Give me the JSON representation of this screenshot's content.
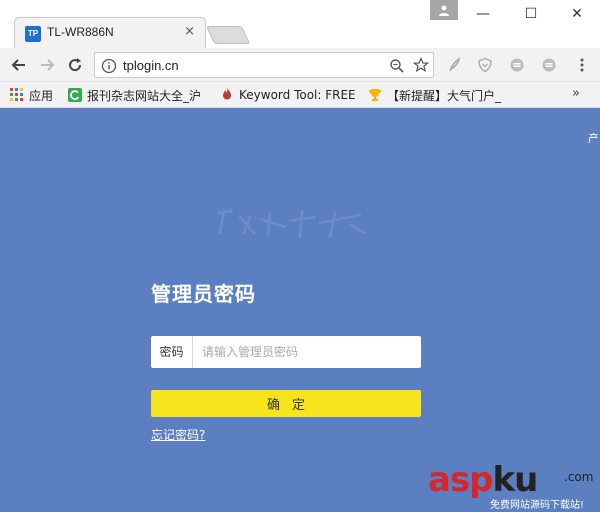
{
  "browser": {
    "tab_title": "TL-WR886N",
    "tab_favicon_text": "TP",
    "tab_close": "×",
    "window_controls": {
      "minimize": "—",
      "maximize": "☐",
      "close": "✕"
    },
    "url": "tplogin.cn"
  },
  "bookmarks": [
    {
      "label": "应用",
      "icon": "apps-grid-icon"
    },
    {
      "label": "报刊杂志网站大全_沪",
      "icon": "refresh-c-icon"
    },
    {
      "label": "Keyword Tool: FREE",
      "icon": "flame-icon"
    },
    {
      "label": "【新提醒】大气门户_",
      "icon": "trophy-icon"
    }
  ],
  "bookmarks_more": "»",
  "page": {
    "corner_text": "产",
    "title": "管理员密码",
    "password_label": "密码",
    "password_placeholder": "请输入管理员密码",
    "password_value": "",
    "confirm_label": "确定",
    "forgot_link": "忘记密码?"
  },
  "watermark": {
    "main_red": "asp",
    "main_dark": "ku",
    "com": ".com",
    "sub": "免费网站源码下载站!"
  },
  "colors": {
    "page_bg": "#5b7fc0",
    "confirm_bg": "#f7e41d",
    "favicon_bg": "#1e6fd1",
    "watermark_red": "#d7262b"
  }
}
